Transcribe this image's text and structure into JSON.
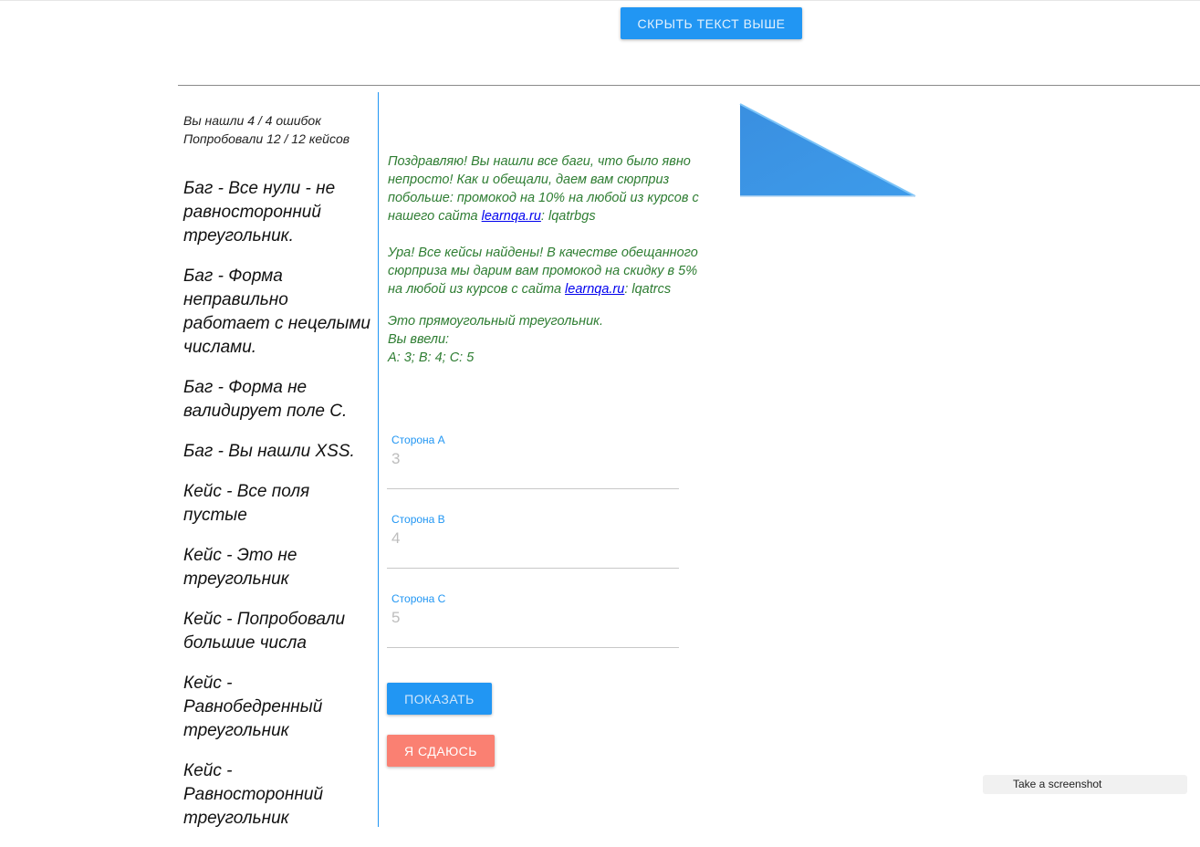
{
  "header": {
    "hide_text_button": "Скрыть текст выше"
  },
  "stats": {
    "bugs_found": "Вы нашли 4 / 4 ошибок",
    "cases_tried": "Попробовали 12 / 12 кейсов"
  },
  "items": [
    "Баг - Все нули - не равносторонний треугольник.",
    "Баг - Форма неправильно работает с нецелыми числами.",
    "Баг - Форма не валидирует поле С.",
    "Баг - Вы нашли XSS.",
    "Кейс - Все поля пустые",
    "Кейс - Это не треугольник",
    "Кейс - Попробовали большие числа",
    "Кейс - Равнобедренный треугольник",
    "Кейс - Равносторонний треугольник"
  ],
  "messages": {
    "bugs_text": "Поздравляю! Вы нашли все баги, что было явно непросто! Как и обещали, даем вам сюрприз побольше: промокод на 10% на любой из курсов с нашего сайта ",
    "bugs_link": "learnqa.ru",
    "bugs_code": ": lqatrbgs",
    "cases_text": "Ура! Все кейсы найдены! В качестве обещанного сюрприза мы дарим вам промокод на скидку в 5% на любой из курсов с сайта ",
    "cases_link": "learnqa.ru",
    "cases_code": ": lqatrcs",
    "result_line1": "Это прямоугольный треугольник.",
    "result_line2": "Вы ввели:",
    "result_line3": "A: 3; B: 4; C: 5"
  },
  "form": {
    "side_a": {
      "label": "Сторона A",
      "value": "3"
    },
    "side_b": {
      "label": "Сторона B",
      "value": "4"
    },
    "side_c": {
      "label": "Сторона C",
      "value": "5"
    },
    "show_button": "Показать",
    "give_up_button": "Я сдаюсь"
  },
  "triangle": {
    "type": "right",
    "color": "#3a96e8"
  },
  "screenshot_tooltip": "Take a screenshot"
}
